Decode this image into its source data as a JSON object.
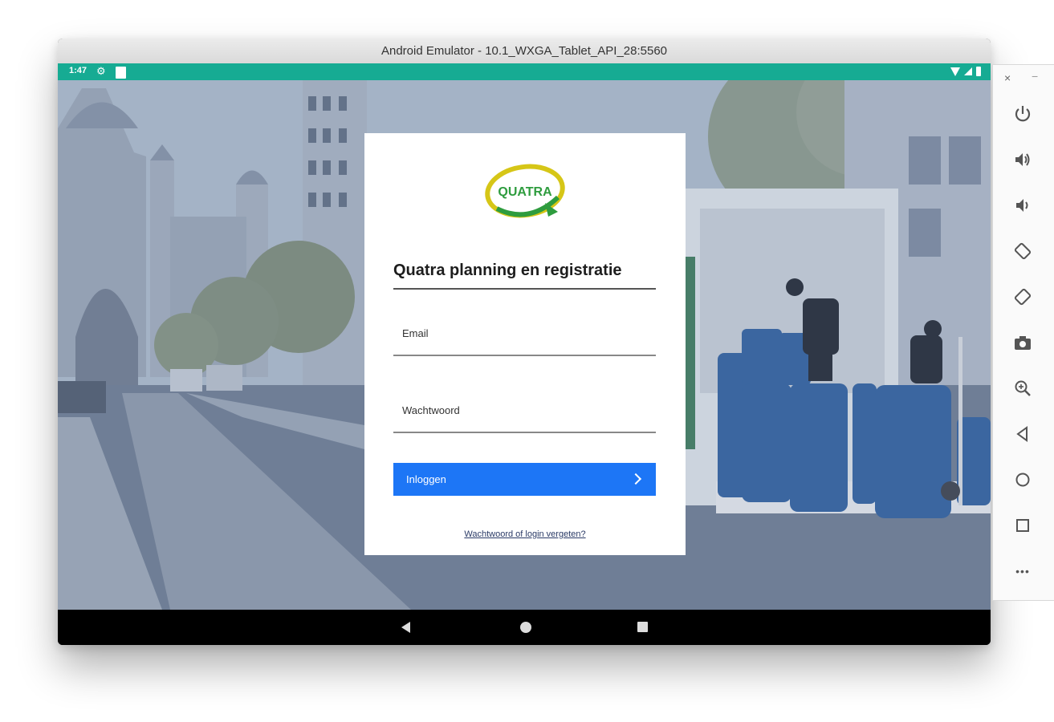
{
  "window": {
    "title": "Android Emulator - 10.1_WXGA_Tablet_API_28:5560"
  },
  "status_bar": {
    "time": "1:47",
    "color": "#16ab93"
  },
  "login": {
    "logo_text": "QUATRA",
    "title": "Quatra planning en registratie",
    "email_label": "Email",
    "email_value": "",
    "password_label": "Wachtwoord",
    "password_value": "",
    "login_button": "Inloggen",
    "forgot_link": "Wachtwoord of login vergeten?",
    "accent_color": "#1d76f6"
  },
  "nav_bar": {
    "buttons": [
      "back-icon",
      "home-icon",
      "recents-icon"
    ]
  },
  "emulator_toolbar": {
    "close": "×",
    "minimize": "−",
    "tools": [
      "power-icon",
      "volume-up-icon",
      "volume-down-icon",
      "rotate-left-icon",
      "rotate-right-icon",
      "camera-icon",
      "zoom-icon",
      "back-icon",
      "home-icon",
      "overview-icon",
      "more-icon"
    ],
    "more": "•••"
  }
}
